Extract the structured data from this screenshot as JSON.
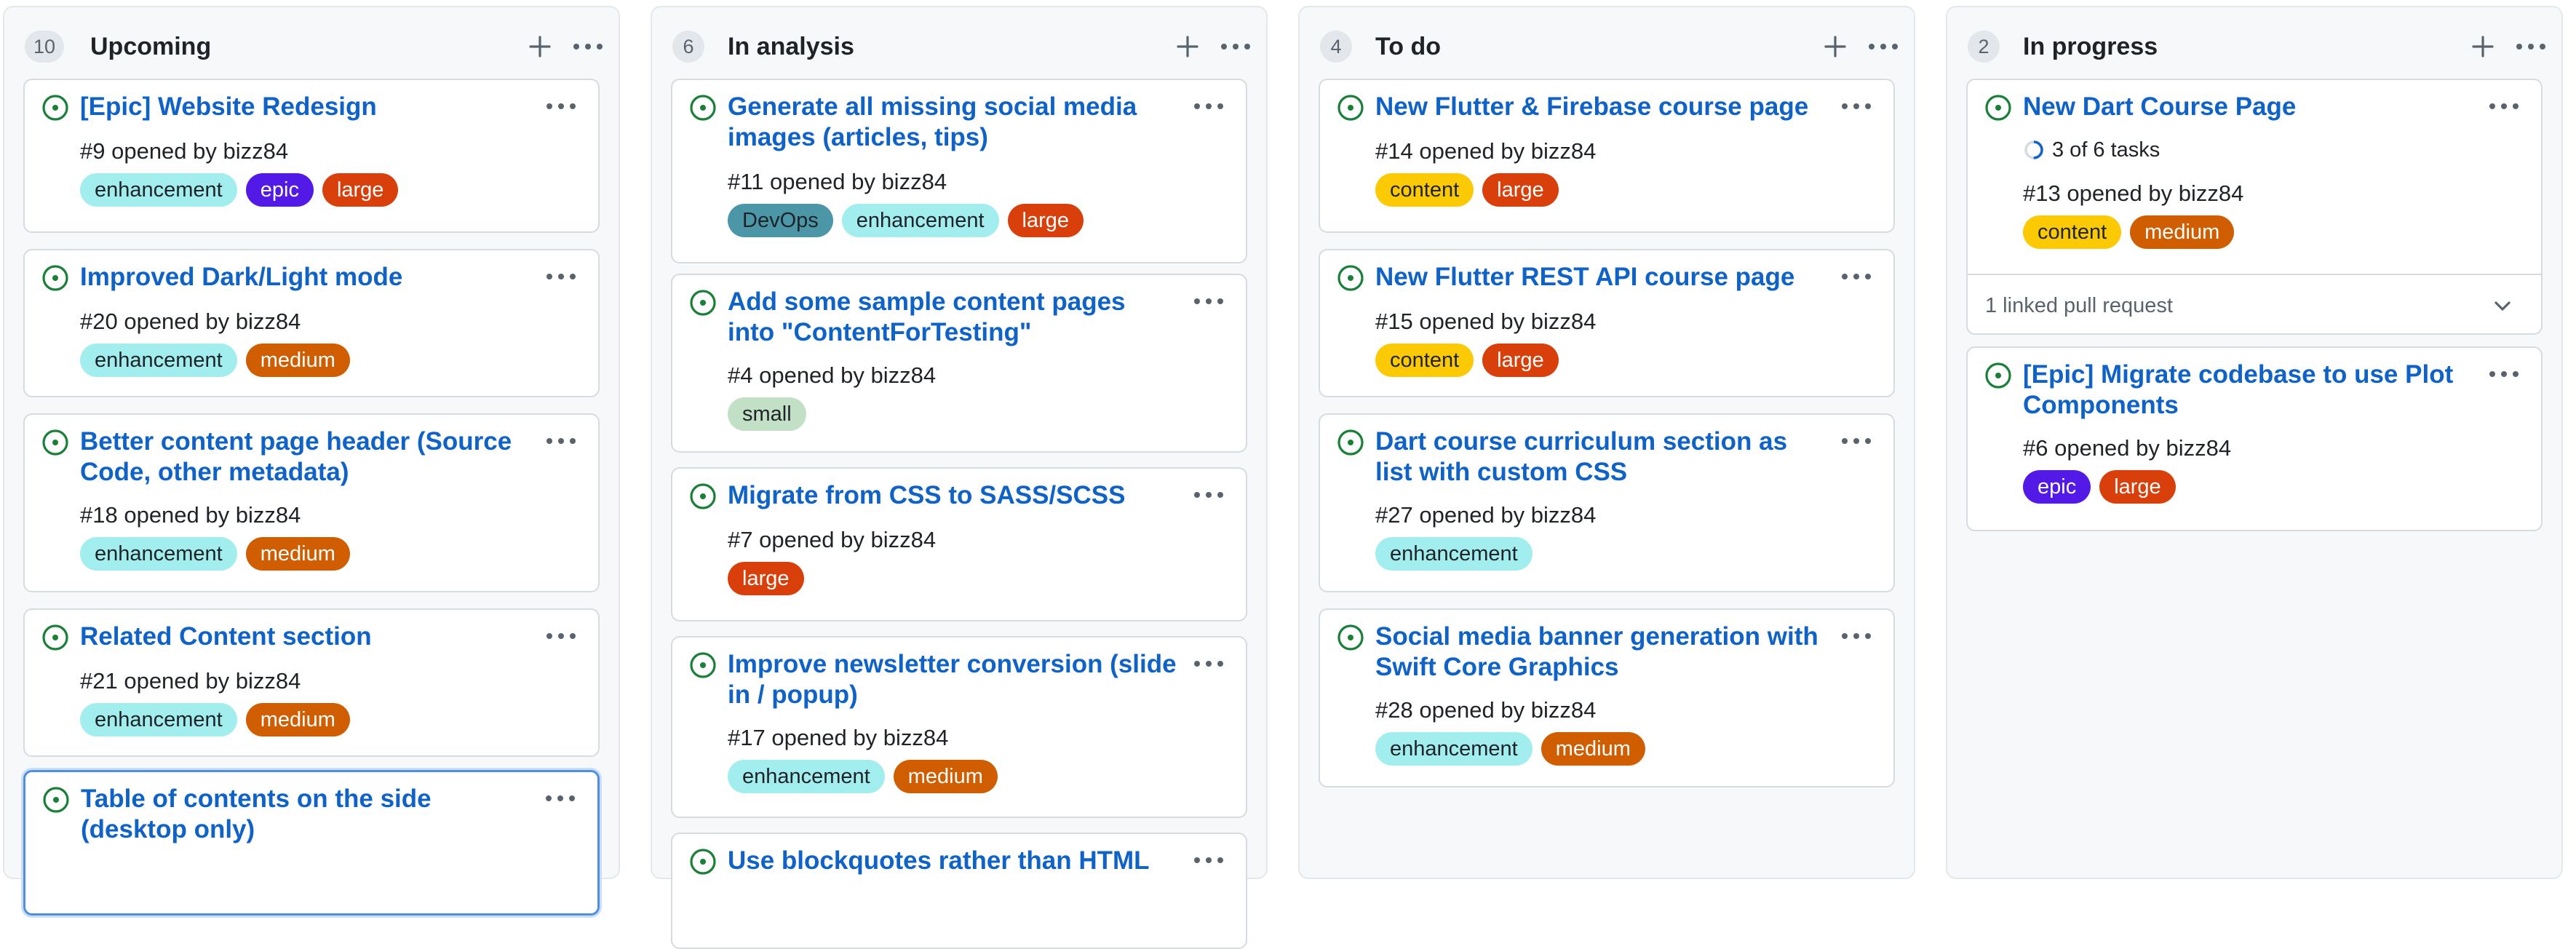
{
  "colors": {
    "link": "#0f62c7",
    "open_icon": "#1a7f37",
    "column_bg": "#f6f8fa",
    "card_border": "#d5dbe1",
    "selected_border": "#4f8fde"
  },
  "labels": {
    "enhancement": {
      "text": "enhancement",
      "bg": "#a2eeef",
      "fg": "#1f2328"
    },
    "epic": {
      "text": "epic",
      "bg": "#5319e7",
      "fg": "#ffffff"
    },
    "large": {
      "text": "large",
      "bg": "#d93f0b",
      "fg": "#ffffff"
    },
    "medium": {
      "text": "medium",
      "bg": "#d05d00",
      "fg": "#ffffff"
    },
    "small": {
      "text": "small",
      "bg": "#c2e0c6",
      "fg": "#1f2328"
    },
    "content": {
      "text": "content",
      "bg": "#fbca04",
      "fg": "#1f2328"
    },
    "devops": {
      "text": "DevOps",
      "bg": "#4b97a8",
      "fg": "#1f2328"
    }
  },
  "columns": [
    {
      "count": "10",
      "title": "Upcoming",
      "add_icon": "plus-icon",
      "menu_icon": "kebab-horizontal-icon",
      "cards": [
        {
          "title": "[Epic] Website Redesign",
          "meta": "#9 opened by bizz84",
          "labels": [
            "enhancement",
            "epic",
            "large"
          ]
        },
        {
          "title": "Improved Dark/Light mode",
          "meta": "#20 opened by bizz84",
          "labels": [
            "enhancement",
            "medium"
          ]
        },
        {
          "title": "Better content page header (Source Code, other metadata)",
          "meta": "#18 opened by bizz84",
          "labels": [
            "enhancement",
            "medium"
          ]
        },
        {
          "title": "Related Content section",
          "meta": "#21 opened by bizz84",
          "labels": [
            "enhancement",
            "medium"
          ]
        },
        {
          "title": "Table of contents on the side (desktop only)",
          "meta": "",
          "labels": [],
          "selected": true
        }
      ]
    },
    {
      "count": "6",
      "title": "In analysis",
      "add_icon": "plus-icon",
      "menu_icon": "kebab-horizontal-icon",
      "cards": [
        {
          "title": "Generate all missing social media images (articles, tips)",
          "meta": "#11 opened by bizz84",
          "labels": [
            "devops",
            "enhancement",
            "large"
          ]
        },
        {
          "title": "Add some sample content pages into \"ContentForTesting\"",
          "meta": "#4 opened by bizz84",
          "labels": [
            "small"
          ]
        },
        {
          "title": "Migrate from CSS to SASS/SCSS",
          "meta": "#7 opened by bizz84",
          "labels": [
            "large"
          ]
        },
        {
          "title": "Improve newsletter conversion (slide in / popup)",
          "meta": "#17 opened by bizz84",
          "labels": [
            "enhancement",
            "medium"
          ]
        },
        {
          "title": "Use blockquotes rather than HTML",
          "meta": "",
          "labels": []
        }
      ]
    },
    {
      "count": "4",
      "title": "To do",
      "add_icon": "plus-icon",
      "menu_icon": "kebab-horizontal-icon",
      "cards": [
        {
          "title": "New Flutter & Firebase course page",
          "meta": "#14 opened by bizz84",
          "labels": [
            "content",
            "large"
          ]
        },
        {
          "title": "New Flutter REST API course page",
          "meta": "#15 opened by bizz84",
          "labels": [
            "content",
            "large"
          ]
        },
        {
          "title": "Dart course curriculum section as list with custom CSS",
          "meta": "#27 opened by bizz84",
          "labels": [
            "enhancement"
          ]
        },
        {
          "title": "Social media banner generation with Swift Core Graphics",
          "meta": "#28 opened by bizz84",
          "labels": [
            "enhancement",
            "medium"
          ]
        }
      ]
    },
    {
      "count": "2",
      "title": "In progress",
      "add_icon": "plus-icon",
      "menu_icon": "kebab-horizontal-icon",
      "cards": [
        {
          "title": "New Dart Course Page",
          "tasks": "3 of 6 tasks",
          "tasks_progress": 0.5,
          "meta": "#13 opened by bizz84",
          "labels": [
            "content",
            "medium"
          ],
          "linked": "1 linked pull request"
        },
        {
          "title": "[Epic] Migrate codebase to use Plot Components",
          "meta": "#6 opened by bizz84",
          "labels": [
            "epic",
            "large"
          ]
        }
      ]
    }
  ]
}
